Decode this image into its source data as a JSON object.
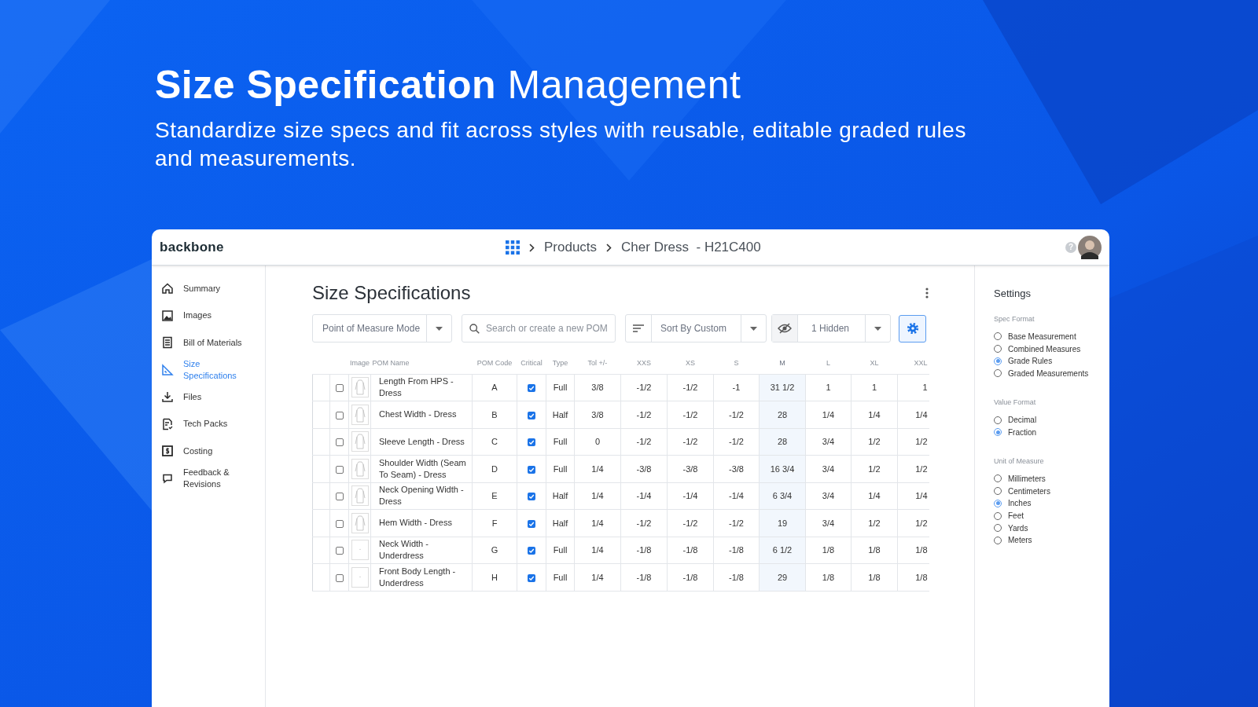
{
  "hero": {
    "title_bold": "Size Specification",
    "title_rest": "Management",
    "subtitle": "Standardize size specs and fit across styles with reusable, editable graded rules and measurements."
  },
  "app": {
    "logo": "backbone",
    "breadcrumbs": [
      "Products",
      "Cher Dress  - H21C400"
    ],
    "help_icon": "?"
  },
  "sidebar": {
    "items": [
      {
        "label": "Summary",
        "kind": "home",
        "selected": false
      },
      {
        "label": "Images",
        "kind": "image",
        "selected": false
      },
      {
        "label": "Bill of Materials",
        "kind": "list",
        "selected": false
      },
      {
        "label": "Size Specifications",
        "kind": "ruler",
        "selected": true
      },
      {
        "label": "Files",
        "kind": "download",
        "selected": false
      },
      {
        "label": "Tech Packs",
        "kind": "doc",
        "selected": false
      },
      {
        "label": "Costing",
        "kind": "dollar",
        "selected": false
      },
      {
        "label": "Feedback & Revisions",
        "kind": "chat",
        "selected": false
      }
    ]
  },
  "page": {
    "title": "Size Specifications"
  },
  "toolbar": {
    "mode": "Point of Measure Mode",
    "search_placeholder": "Search or create a new POM",
    "sort": "Sort By Custom",
    "hidden": "1 Hidden"
  },
  "table": {
    "columns": [
      "Image",
      "POM Name",
      "POM Code",
      "Critical",
      "Type",
      "Tol +/-"
    ],
    "size_columns": [
      {
        "label": "XXS",
        "base": false
      },
      {
        "label": "XS",
        "base": false
      },
      {
        "label": "S",
        "base": false
      },
      {
        "label": "M",
        "base": true
      },
      {
        "label": "L",
        "base": false
      },
      {
        "label": "XL",
        "base": false
      },
      {
        "label": "XXL",
        "base": false
      }
    ],
    "rows": [
      {
        "checked": false,
        "kind": "dress",
        "name": "Length From HPS - Dress",
        "code": "A",
        "critical": true,
        "type": "Full",
        "tol": "3/8",
        "sizes": [
          "-1/2",
          "-1/2",
          "-1",
          "31 1/2",
          "1",
          "1",
          "1"
        ]
      },
      {
        "checked": false,
        "kind": "dress",
        "name": "Chest Width - Dress",
        "code": "B",
        "critical": true,
        "type": "Half",
        "tol": "3/8",
        "sizes": [
          "-1/2",
          "-1/2",
          "-1/2",
          "28",
          "1/4",
          "1/4",
          "1/4"
        ]
      },
      {
        "checked": false,
        "kind": "dress",
        "name": "Sleeve Length - Dress",
        "code": "C",
        "critical": true,
        "type": "Full",
        "tol": "0",
        "sizes": [
          "-1/2",
          "-1/2",
          "-1/2",
          "28",
          "3/4",
          "1/2",
          "1/2"
        ]
      },
      {
        "checked": false,
        "kind": "dress",
        "name": "Shoulder Width (Seam To Seam) - Dress",
        "code": "D",
        "critical": true,
        "type": "Full",
        "tol": "1/4",
        "sizes": [
          "-3/8",
          "-3/8",
          "-3/8",
          "16 3/4",
          "3/4",
          "1/2",
          "1/2"
        ]
      },
      {
        "checked": false,
        "kind": "dress",
        "name": "Neck Opening Width - Dress",
        "code": "E",
        "critical": true,
        "type": "Half",
        "tol": "1/4",
        "sizes": [
          "-1/4",
          "-1/4",
          "-1/4",
          "6 3/4",
          "3/4",
          "1/4",
          "1/4"
        ]
      },
      {
        "checked": false,
        "kind": "dress",
        "name": "Hem Width - Dress",
        "code": "F",
        "critical": true,
        "type": "Half",
        "tol": "1/4",
        "sizes": [
          "-1/2",
          "-1/2",
          "-1/2",
          "19",
          "3/4",
          "1/2",
          "1/2"
        ]
      },
      {
        "checked": false,
        "kind": "blank",
        "name": "Neck Width - Underdress",
        "code": "G",
        "critical": true,
        "type": "Full",
        "tol": "1/4",
        "sizes": [
          "-1/8",
          "-1/8",
          "-1/8",
          "6 1/2",
          "1/8",
          "1/8",
          "1/8"
        ]
      },
      {
        "checked": false,
        "kind": "blank",
        "name": "Front Body Length - Underdress",
        "code": "H",
        "critical": true,
        "type": "Full",
        "tol": "1/4",
        "sizes": [
          "-1/8",
          "-1/8",
          "-1/8",
          "29",
          "1/8",
          "1/8",
          "1/8"
        ]
      }
    ]
  },
  "settings": {
    "title": "Settings",
    "groups": [
      {
        "label": "Spec Format",
        "options": [
          {
            "label": "Base Measurement",
            "selected": false
          },
          {
            "label": "Combined Measures",
            "selected": false
          },
          {
            "label": "Grade Rules",
            "selected": true
          },
          {
            "label": "Graded Measurements",
            "selected": false
          }
        ]
      },
      {
        "label": "Value Format",
        "options": [
          {
            "label": "Decimal",
            "selected": false
          },
          {
            "label": "Fraction",
            "selected": true
          }
        ]
      },
      {
        "label": "Unit of Measure",
        "options": [
          {
            "label": "Millimeters",
            "selected": false
          },
          {
            "label": "Centimeters",
            "selected": false
          },
          {
            "label": "Inches",
            "selected": true
          },
          {
            "label": "Feet",
            "selected": false
          },
          {
            "label": "Yards",
            "selected": false
          },
          {
            "label": "Meters",
            "selected": false
          }
        ]
      }
    ]
  }
}
